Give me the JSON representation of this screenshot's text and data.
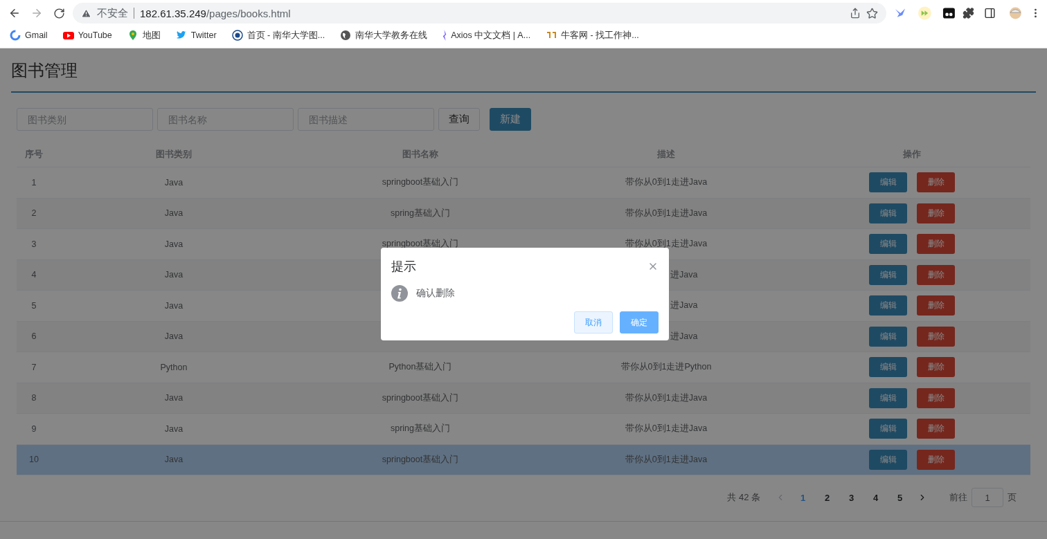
{
  "browser": {
    "security_label": "不安全",
    "url_host": "182.61.35.249",
    "url_path": "/pages/books.html",
    "bookmarks": [
      {
        "kind": "gmail",
        "label": "Gmail"
      },
      {
        "kind": "youtube",
        "label": "YouTube"
      },
      {
        "kind": "maps",
        "label": "地图"
      },
      {
        "kind": "twitter",
        "label": "Twitter"
      },
      {
        "kind": "school",
        "label": "首页 - 南华大学图..."
      },
      {
        "kind": "globe",
        "label": "南华大学教务在线"
      },
      {
        "kind": "axios",
        "label": "Axios 中文文档 | A..."
      },
      {
        "kind": "nowcoder",
        "label": "牛客网 - 找工作神..."
      }
    ]
  },
  "page": {
    "title": "图书管理",
    "filters": [
      {
        "placeholder": "图书类别"
      },
      {
        "placeholder": "图书名称"
      },
      {
        "placeholder": "图书描述"
      }
    ],
    "buttons": [
      {
        "kind": "default",
        "label": "查询"
      },
      {
        "kind": "primary",
        "label": "新建"
      }
    ]
  },
  "table": {
    "columns": [
      "序号",
      "图书类别",
      "图书名称",
      "描述",
      "操作"
    ],
    "rows": [
      {
        "index": "1",
        "category": "Java",
        "name": "springboot基础入门",
        "description": "带你从0到1走进Java",
        "edit": "编辑",
        "delete": "删除",
        "highlighted": false,
        "covered": false
      },
      {
        "index": "2",
        "category": "Java",
        "name": "spring基础入门",
        "description": "带你从0到1走进Java",
        "edit": "编辑",
        "delete": "删除",
        "highlighted": false,
        "covered": false
      },
      {
        "index": "3",
        "category": "Java",
        "name": "springboot基础入门",
        "description": "带你从0到1走进Java",
        "edit": "编辑",
        "delete": "删除",
        "highlighted": false,
        "covered": false
      },
      {
        "index": "4",
        "category": "Java",
        "description": "进Java",
        "edit": "编辑",
        "delete": "删除",
        "highlighted": false,
        "covered": true
      },
      {
        "index": "5",
        "category": "Java",
        "description": "进Java",
        "edit": "编辑",
        "delete": "删除",
        "highlighted": false,
        "covered": true
      },
      {
        "index": "6",
        "category": "Java",
        "description": "进Java",
        "edit": "编辑",
        "delete": "删除",
        "highlighted": false,
        "covered": true
      },
      {
        "index": "7",
        "category": "Python",
        "name": "Python基础入门",
        "description": "带你从0到1走进Python",
        "edit": "编辑",
        "delete": "删除",
        "highlighted": false,
        "covered": false
      },
      {
        "index": "8",
        "category": "Java",
        "name": "springboot基础入门",
        "description": "带你从0到1走进Java",
        "edit": "编辑",
        "delete": "删除",
        "highlighted": false,
        "covered": false
      },
      {
        "index": "9",
        "category": "Java",
        "name": "spring基础入门",
        "description": "带你从0到1走进Java",
        "edit": "编辑",
        "delete": "删除",
        "highlighted": false,
        "covered": false
      },
      {
        "index": "10",
        "category": "Java",
        "name": "springboot基础入门",
        "description": "带你从0到1走进Java",
        "edit": "编辑",
        "delete": "删除",
        "highlighted": true,
        "covered": false
      }
    ]
  },
  "pagination": {
    "total": "共 42 条",
    "prev": {
      "disabled": true
    },
    "next": {
      "disabled": false
    },
    "pages": [
      {
        "label": "1",
        "selected": true
      },
      {
        "label": "2",
        "selected": false
      },
      {
        "label": "3",
        "selected": false
      },
      {
        "label": "4",
        "selected": false
      },
      {
        "label": "5",
        "selected": false
      }
    ],
    "goto_label": "前往",
    "goto_value": "1",
    "goto_unit": "页"
  },
  "dialog": {
    "title": "提示",
    "message": "确认删除",
    "buttons": [
      {
        "kind": "cancel",
        "label": "取消"
      },
      {
        "kind": "confirm",
        "label": "确定"
      }
    ]
  }
}
